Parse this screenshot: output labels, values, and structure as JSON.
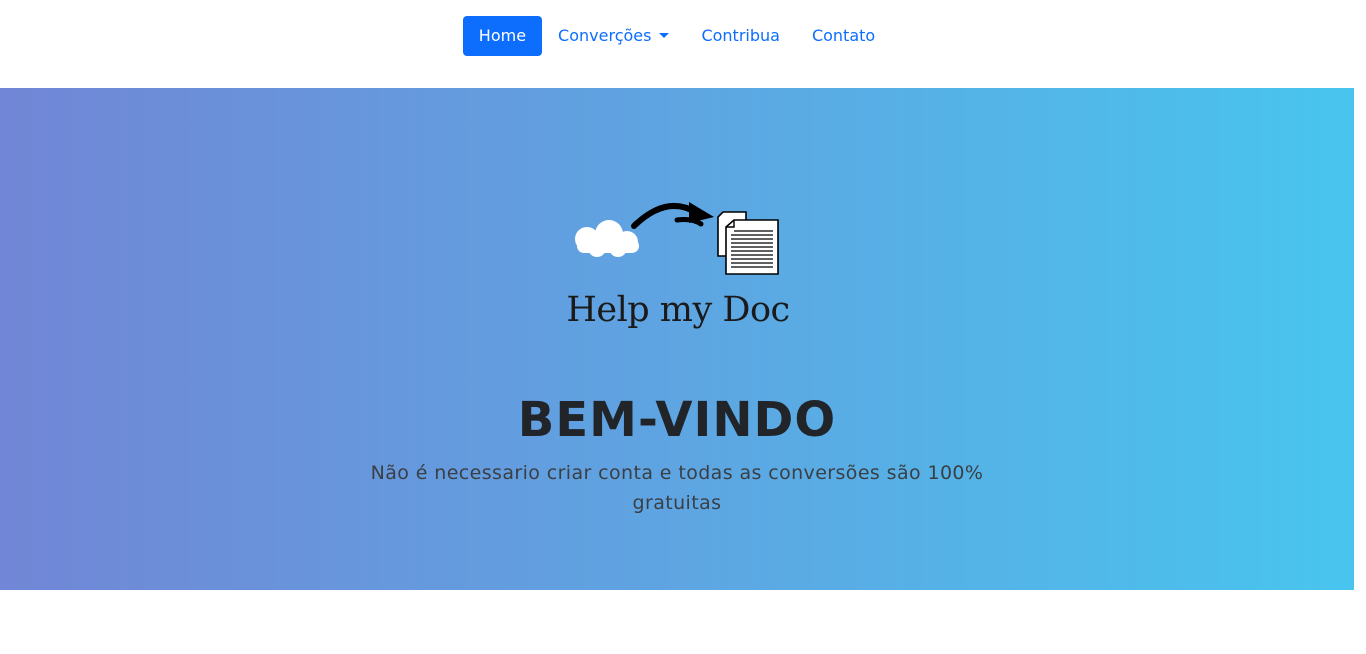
{
  "nav": {
    "items": [
      {
        "label": "Home",
        "active": true
      },
      {
        "label": "Converções",
        "dropdown": true
      },
      {
        "label": "Contribua"
      },
      {
        "label": "Contato"
      }
    ]
  },
  "hero": {
    "logo_text": "Help my Doc",
    "title": "BEM-VINDO",
    "subtitle": "Não é necessario criar conta e todas as conversões são 100% gratuitas"
  },
  "colors": {
    "accent": "#0d6efd",
    "gradient_start": "#7186d6",
    "gradient_end": "#48c5ee",
    "title": "#212529"
  },
  "icons": [
    "cloud-icon",
    "arrow-icon",
    "document-icon",
    "caret-down-icon"
  ]
}
